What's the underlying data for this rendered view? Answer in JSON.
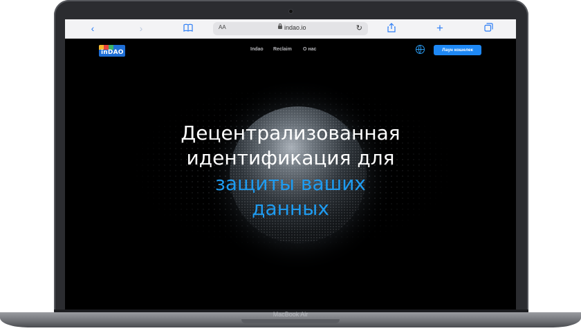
{
  "browser": {
    "text_size_label": "AA",
    "url": "indao.io",
    "icons": [
      "back-icon",
      "forward-icon",
      "bookmarks-icon",
      "lock-icon",
      "reload-icon",
      "share-icon",
      "new-tab-icon",
      "tabs-icon"
    ]
  },
  "site": {
    "logo_text": "inDAO",
    "nav": [
      "Indao",
      "Reclaim",
      "О нас"
    ],
    "launch_button": "Лаун кошелек"
  },
  "hero": {
    "line1": "Децентрализованная",
    "line2": "идентификация для",
    "line3": "защиты ваших",
    "line4": "данных"
  },
  "device": {
    "model": "MacBook Air"
  },
  "colors": {
    "accent": "#1e88f5",
    "headline_blue": "#1e9bf0",
    "background": "#000000"
  }
}
